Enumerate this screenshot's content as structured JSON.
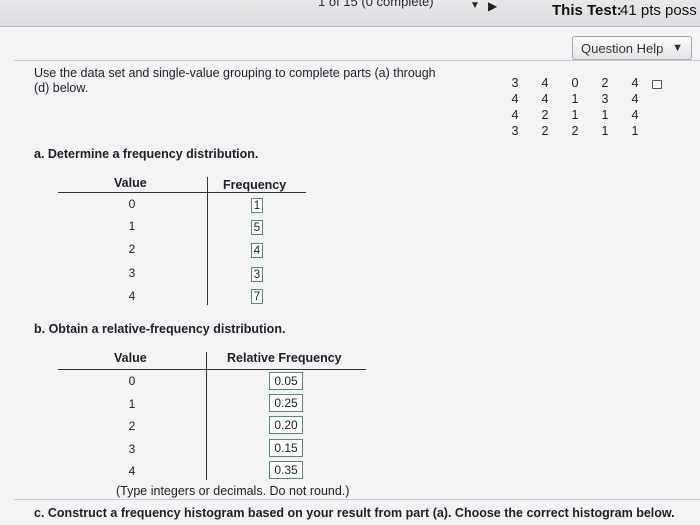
{
  "topbar": {
    "progress": "1 of 15 (0 complete)",
    "test_label": "This Test:",
    "test_score": "41 pts poss"
  },
  "help_button": {
    "label": "Question Help"
  },
  "instructions": "Use the data set and single-value grouping to complete parts (a) through (d) below.",
  "dataset": [
    [
      "3",
      "4",
      "0",
      "2",
      "4"
    ],
    [
      "4",
      "4",
      "1",
      "3",
      "4"
    ],
    [
      "4",
      "2",
      "1",
      "1",
      "4"
    ],
    [
      "3",
      "2",
      "2",
      "1",
      "1"
    ]
  ],
  "part_a": {
    "label": "a. Determine a frequency distribution.",
    "headers": {
      "value": "Value",
      "frequency": "Frequency"
    },
    "values": [
      "0",
      "1",
      "2",
      "3",
      "4"
    ],
    "frequencies": [
      "1",
      "5",
      "4",
      "3",
      "7"
    ]
  },
  "part_b": {
    "label": "b. Obtain a relative-frequency distribution.",
    "headers": {
      "value": "Value",
      "relative": "Relative Frequency"
    },
    "values": [
      "0",
      "1",
      "2",
      "3",
      "4"
    ],
    "relative": [
      "0.05",
      "0.25",
      "0.20",
      "0.15",
      "0.35"
    ],
    "note": "(Type integers or decimals. Do not round.)"
  },
  "part_c": {
    "label": "c. Construct a frequency histogram based on your result from part (a). Choose the correct histogram below."
  }
}
